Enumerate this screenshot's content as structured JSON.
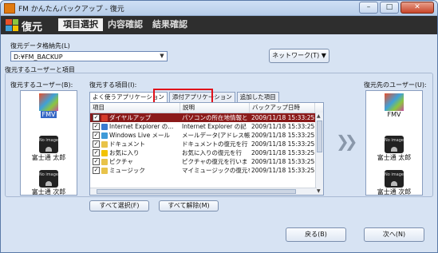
{
  "window": {
    "title": "FM かんたんバックアップ - 復元",
    "btn_min": "–",
    "btn_max": "□",
    "btn_close": "✕"
  },
  "header": {
    "title": "復元",
    "steps": [
      "項目選択",
      "内容確認",
      "結果確認"
    ],
    "logo_colors": [
      "#e8502a",
      "#8cc63f",
      "#3fa0d8",
      "#f2c200"
    ]
  },
  "dest": {
    "label": "復元データ格納先(L)",
    "value": "D:¥FM_BACKUP",
    "network_button": "ネットワーク(T) ▼"
  },
  "group_label": "復元するユーザーと項目",
  "source_users": {
    "label": "復元するユーザー(B):",
    "items": [
      {
        "name": "FMV",
        "icon": "fmv-user-icon",
        "selected": true
      },
      {
        "name": "富士通 太郎",
        "icon": "no-image-icon",
        "selected": false
      },
      {
        "name": "富士通 次郎",
        "icon": "no-image-icon",
        "selected": false
      }
    ],
    "no_image_text": "No image"
  },
  "items_panel": {
    "label": "復元する項目(I):",
    "tabs": [
      "よく使うアプリケーション",
      "添付アプリケーション",
      "追加した項目"
    ],
    "columns": [
      "項目",
      "説明",
      "バックアップ日時"
    ],
    "rows": [
      {
        "checked": true,
        "icon_color": "#d53a2a",
        "name": "ダイヤルアップ",
        "desc": "パソコンの所在地情報と",
        "date": "2009/11/18 15:33:25",
        "selected": true
      },
      {
        "checked": true,
        "icon_color": "#3a7ad0",
        "name": "Internet Explorer の...",
        "desc": "Internet Explorer の記",
        "date": "2009/11/18 15:33:25",
        "selected": false
      },
      {
        "checked": true,
        "icon_color": "#3f9ad8",
        "name": "Windows Live メール",
        "desc": "メールデータ(アドレス帳)",
        "date": "2009/11/18 15:33:25",
        "selected": false
      },
      {
        "checked": true,
        "icon_color": "#e8c34a",
        "name": "ドキュメント",
        "desc": "ドキュメントの復元を行",
        "date": "2009/11/18 15:33:25",
        "selected": false
      },
      {
        "checked": true,
        "icon_color": "#f2c200",
        "name": "お気に入り",
        "desc": "お気に入りの復元を行",
        "date": "2009/11/18 15:33:25",
        "selected": false
      },
      {
        "checked": true,
        "icon_color": "#e8c34a",
        "name": "ピクチャ",
        "desc": "ピクチャの復元を行いま",
        "date": "2009/11/18 15:33:25",
        "selected": false
      },
      {
        "checked": true,
        "icon_color": "#e8c34a",
        "name": "ミュージック",
        "desc": "マイミュージックの復元を",
        "date": "2009/11/18 15:33:25",
        "selected": false
      }
    ],
    "select_all": "すべて選択(F)",
    "deselect_all": "すべて解除(M)"
  },
  "dest_users": {
    "label": "復元先のユーザー(U):",
    "items": [
      {
        "name": "FMV",
        "icon": "fmv-user-icon"
      },
      {
        "name": "富士通 太郎",
        "icon": "no-image-icon"
      },
      {
        "name": "富士通 次郎",
        "icon": "no-image-icon"
      }
    ]
  },
  "nav": {
    "back": "戻る(B)",
    "next": "次へ(N)"
  }
}
